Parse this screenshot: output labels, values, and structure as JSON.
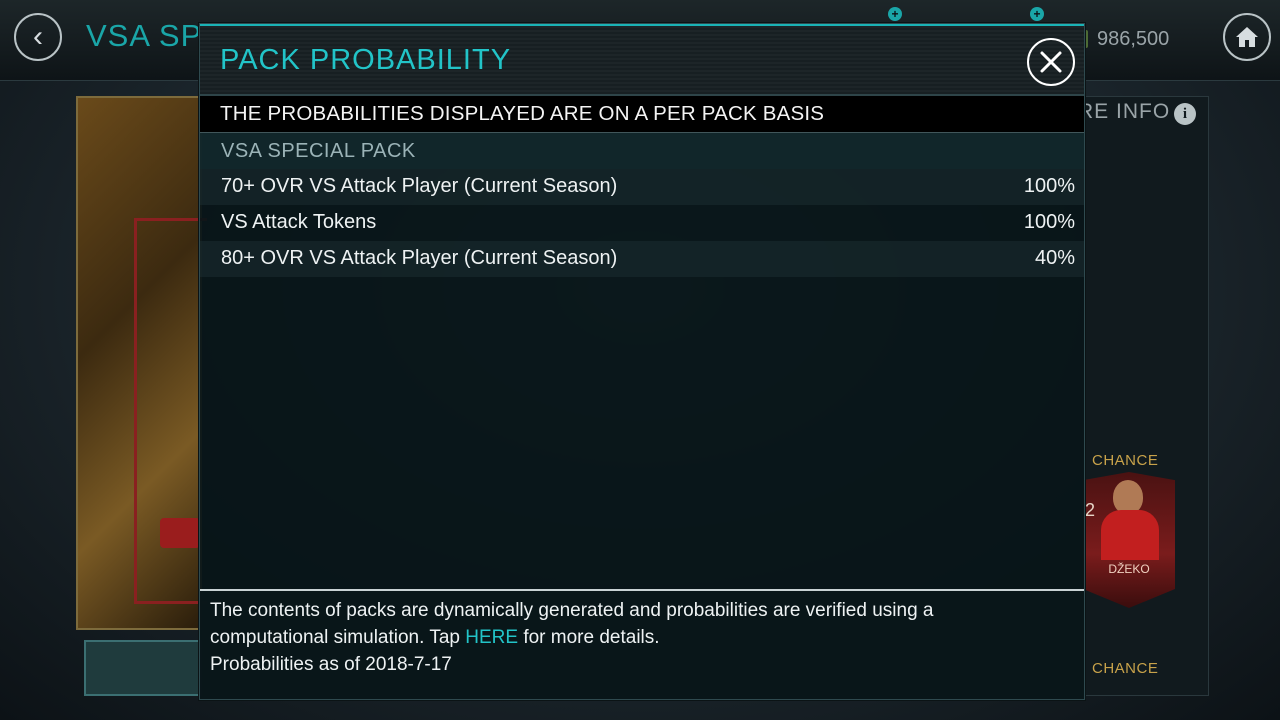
{
  "background": {
    "title": "VSA SPE",
    "coins": "986,500",
    "more_info": "RE INFO",
    "chance_label_1": "CHANCE",
    "chance_label_2": "CHANCE",
    "player_name": "DŽEKO",
    "player_rating_partial": "2"
  },
  "modal": {
    "title": "PACK PROBABILITY",
    "notice": "THE PROBABILITIES DISPLAYED ARE ON A PER PACK BASIS",
    "pack_name": "VSA SPECIAL PACK",
    "items": [
      {
        "label": "70+ OVR VS Attack Player (Current Season)",
        "value": "100%"
      },
      {
        "label": "VS Attack Tokens",
        "value": "100%"
      },
      {
        "label": "80+ OVR VS Attack Player (Current Season)",
        "value": "40%"
      }
    ],
    "footer": {
      "line1": "The contents of packs are dynamically generated and probabilities are verified using a",
      "line2_pre": "computational simulation. Tap ",
      "link": "HERE",
      "line2_post": " for more details.",
      "line3": "Probabilities as of 2018-7-17"
    }
  },
  "colors": {
    "accent": "#22c4c8",
    "chance": "#c8a24a"
  }
}
